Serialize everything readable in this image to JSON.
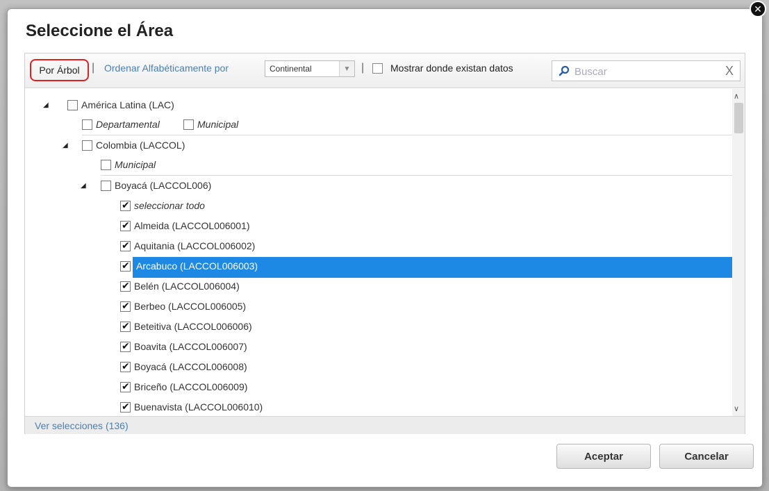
{
  "dialog": {
    "title": "Seleccione el Área",
    "close_glyph": "✕"
  },
  "toolbar": {
    "tab_tree": "Por Árbol",
    "separator": "|",
    "sort_link": "Ordenar Alfabéticamente por",
    "sort_select_value": "Continental",
    "show_data_label": "Mostrar donde existan datos",
    "search_placeholder": "Buscar",
    "search_clear": "X"
  },
  "tree": {
    "rows": [
      {
        "label": "América Latina (LAC)",
        "expanded": true,
        "checked": false,
        "italic": false
      },
      {
        "label_a": "Departamental",
        "label_b": "Municipal"
      },
      {
        "label": "Colombia (LACCOL)",
        "expanded": true,
        "checked": false,
        "italic": false
      },
      {
        "label": "Municipal",
        "checked": false,
        "italic": true
      },
      {
        "label": "Boyacá (LACCOL006)",
        "expanded": true,
        "checked": false,
        "italic": false
      },
      {
        "label": "seleccionar todo",
        "checked": true,
        "italic": true
      },
      {
        "label": "Almeida (LACCOL006001)",
        "checked": true
      },
      {
        "label": "Aquitania (LACCOL006002)",
        "checked": true
      },
      {
        "label": "Arcabuco (LACCOL006003)",
        "checked": true,
        "selected": true
      },
      {
        "label": "Belén (LACCOL006004)",
        "checked": true
      },
      {
        "label": "Berbeo (LACCOL006005)",
        "checked": true
      },
      {
        "label": "Beteitiva (LACCOL006006)",
        "checked": true
      },
      {
        "label": "Boavita (LACCOL006007)",
        "checked": true
      },
      {
        "label": "Boyacá (LACCOL006008)",
        "checked": true
      },
      {
        "label": "Briceño (LACCOL006009)",
        "checked": true
      },
      {
        "label": "Buenavista (LACCOL006010)",
        "checked": true
      }
    ]
  },
  "footer": {
    "view_selections": "Ver selecciones (136)"
  },
  "buttons": {
    "accept": "Aceptar",
    "cancel": "Cancelar"
  },
  "colors": {
    "highlight": "#1e88e5",
    "link": "#4a7fb3",
    "tab_outline": "#e02020"
  }
}
